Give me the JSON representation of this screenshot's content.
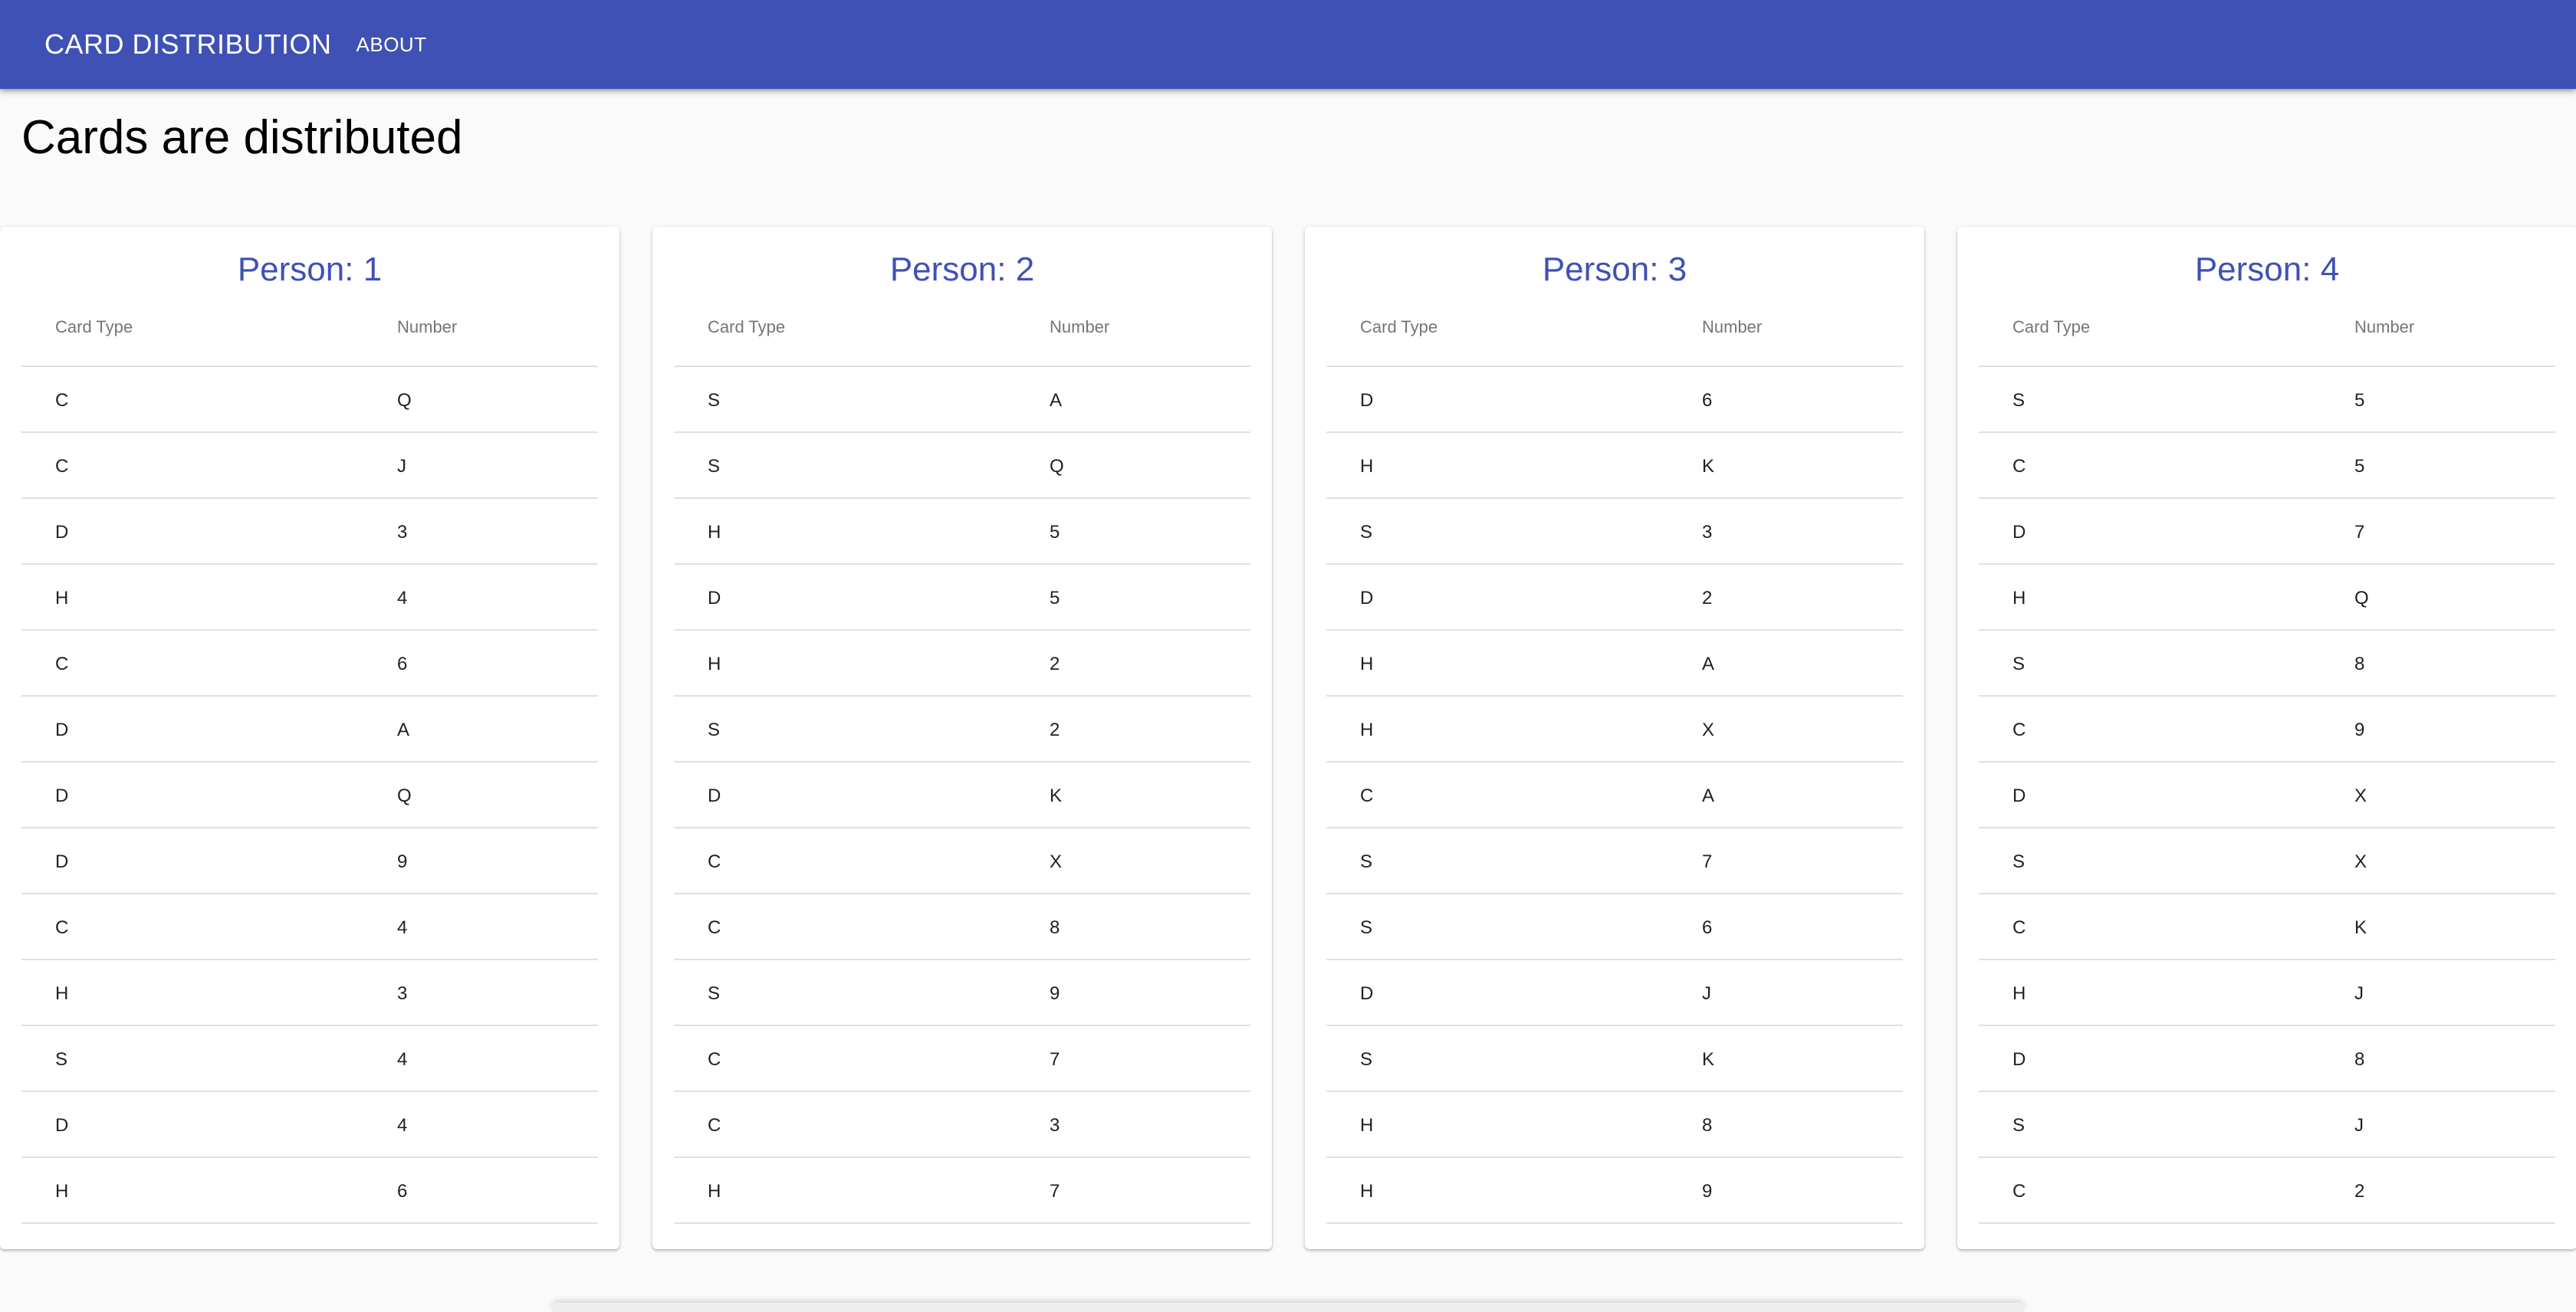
{
  "appbar": {
    "title": "CARD DISTRIBUTION",
    "nav_about": "ABOUT",
    "color": "#3f51b5"
  },
  "page": {
    "headline": "Cards are distributed"
  },
  "table_headers": {
    "card_type": "Card Type",
    "number": "Number"
  },
  "persons": [
    {
      "title": "Person: 1",
      "rows": [
        [
          "C",
          "Q"
        ],
        [
          "C",
          "J"
        ],
        [
          "D",
          "3"
        ],
        [
          "H",
          "4"
        ],
        [
          "C",
          "6"
        ],
        [
          "D",
          "A"
        ],
        [
          "D",
          "Q"
        ],
        [
          "D",
          "9"
        ],
        [
          "C",
          "4"
        ],
        [
          "H",
          "3"
        ],
        [
          "S",
          "4"
        ],
        [
          "D",
          "4"
        ],
        [
          "H",
          "6"
        ]
      ]
    },
    {
      "title": "Person: 2",
      "rows": [
        [
          "S",
          "A"
        ],
        [
          "S",
          "Q"
        ],
        [
          "H",
          "5"
        ],
        [
          "D",
          "5"
        ],
        [
          "H",
          "2"
        ],
        [
          "S",
          "2"
        ],
        [
          "D",
          "K"
        ],
        [
          "C",
          "X"
        ],
        [
          "C",
          "8"
        ],
        [
          "S",
          "9"
        ],
        [
          "C",
          "7"
        ],
        [
          "C",
          "3"
        ],
        [
          "H",
          "7"
        ]
      ]
    },
    {
      "title": "Person: 3",
      "rows": [
        [
          "D",
          "6"
        ],
        [
          "H",
          "K"
        ],
        [
          "S",
          "3"
        ],
        [
          "D",
          "2"
        ],
        [
          "H",
          "A"
        ],
        [
          "H",
          "X"
        ],
        [
          "C",
          "A"
        ],
        [
          "S",
          "7"
        ],
        [
          "S",
          "6"
        ],
        [
          "D",
          "J"
        ],
        [
          "S",
          "K"
        ],
        [
          "H",
          "8"
        ],
        [
          "H",
          "9"
        ]
      ]
    },
    {
      "title": "Person: 4",
      "rows": [
        [
          "S",
          "5"
        ],
        [
          "C",
          "5"
        ],
        [
          "D",
          "7"
        ],
        [
          "H",
          "Q"
        ],
        [
          "S",
          "8"
        ],
        [
          "C",
          "9"
        ],
        [
          "D",
          "X"
        ],
        [
          "S",
          "X"
        ],
        [
          "C",
          "K"
        ],
        [
          "H",
          "J"
        ],
        [
          "D",
          "8"
        ],
        [
          "S",
          "J"
        ],
        [
          "C",
          "2"
        ]
      ]
    }
  ]
}
